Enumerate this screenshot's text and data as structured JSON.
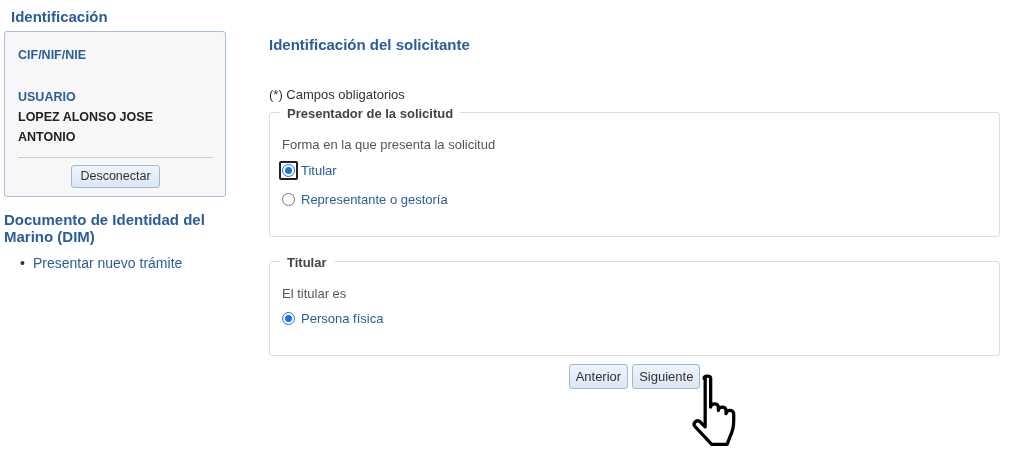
{
  "sidebar": {
    "heading": "Identificación",
    "user_box": {
      "id_label": "CIF/NIF/NIE",
      "user_label": "USUARIO",
      "user_name": "LOPEZ ALONSO JOSE ANTONIO",
      "logout_button": "Desconectar"
    },
    "section_heading": "Documento de Identidad del Marino (DIM)",
    "links": [
      {
        "bullet": "•",
        "label": "Presentar nuevo trámite"
      }
    ]
  },
  "main": {
    "title": "Identificación del solicitante",
    "required_note": "(*) Campos obligatorios",
    "fieldsets": [
      {
        "legend": "Presentador de la solicitud",
        "question": "Forma en la que presenta la solicitud",
        "options": [
          {
            "label": "Titular",
            "selected": true,
            "focused": true
          },
          {
            "label": "Representante o gestoría",
            "selected": false,
            "focused": false
          }
        ]
      },
      {
        "legend": "Titular",
        "question": "El titular es",
        "options": [
          {
            "label": "Persona física",
            "selected": true,
            "focused": false
          }
        ]
      }
    ],
    "buttons": [
      "Anterior",
      "Siguiente"
    ]
  }
}
